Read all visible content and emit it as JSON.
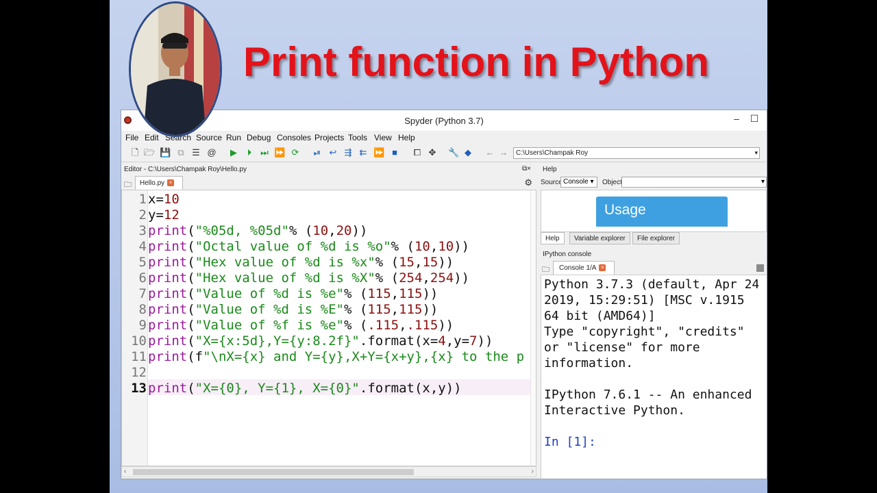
{
  "slide": {
    "headline": "Print function in Python"
  },
  "window": {
    "title": "Spyder (Python 3.7)",
    "minimize": "–",
    "maximize": "☐"
  },
  "menu": [
    "File",
    "Edit",
    "Search",
    "Source",
    "Run",
    "Debug",
    "Consoles",
    "Projects",
    "Tools",
    "View",
    "Help"
  ],
  "toolbar": {
    "path": "C:\\Users\\Champak Roy"
  },
  "editor": {
    "header": "Editor - C:\\Users\\Champak Roy\\Hello.py",
    "tab": "Hello.py",
    "lines": [
      {
        "n": "1",
        "parts": [
          [
            "plain",
            "x="
          ],
          [
            "num",
            "10"
          ]
        ]
      },
      {
        "n": "2",
        "parts": [
          [
            "plain",
            "y="
          ],
          [
            "num",
            "12"
          ]
        ]
      },
      {
        "n": "3",
        "parts": [
          [
            "kw",
            "print"
          ],
          [
            "plain",
            "("
          ],
          [
            "str",
            "\"%05d, %05d\""
          ],
          [
            "plain",
            "% ("
          ],
          [
            "num",
            "10"
          ],
          [
            "plain",
            ","
          ],
          [
            "num",
            "20"
          ],
          [
            "plain",
            "))"
          ]
        ]
      },
      {
        "n": "4",
        "parts": [
          [
            "kw",
            "print"
          ],
          [
            "plain",
            "("
          ],
          [
            "str",
            "\"Octal value of %d is %o\""
          ],
          [
            "plain",
            "% ("
          ],
          [
            "num",
            "10"
          ],
          [
            "plain",
            ","
          ],
          [
            "num",
            "10"
          ],
          [
            "plain",
            "))"
          ]
        ]
      },
      {
        "n": "5",
        "parts": [
          [
            "kw",
            "print"
          ],
          [
            "plain",
            "("
          ],
          [
            "str",
            "\"Hex value of %d is %x\""
          ],
          [
            "plain",
            "% ("
          ],
          [
            "num",
            "15"
          ],
          [
            "plain",
            ","
          ],
          [
            "num",
            "15"
          ],
          [
            "plain",
            "))"
          ]
        ]
      },
      {
        "n": "6",
        "parts": [
          [
            "kw",
            "print"
          ],
          [
            "plain",
            "("
          ],
          [
            "str",
            "\"Hex value of %d is %X\""
          ],
          [
            "plain",
            "% ("
          ],
          [
            "num",
            "254"
          ],
          [
            "plain",
            ","
          ],
          [
            "num",
            "254"
          ],
          [
            "plain",
            "))"
          ]
        ]
      },
      {
        "n": "7",
        "parts": [
          [
            "kw",
            "print"
          ],
          [
            "plain",
            "("
          ],
          [
            "str",
            "\"Value of %d is %e\""
          ],
          [
            "plain",
            "% ("
          ],
          [
            "num",
            "115"
          ],
          [
            "plain",
            ","
          ],
          [
            "num",
            "115"
          ],
          [
            "plain",
            "))"
          ]
        ]
      },
      {
        "n": "8",
        "parts": [
          [
            "kw",
            "print"
          ],
          [
            "plain",
            "("
          ],
          [
            "str",
            "\"Value of %d is %E\""
          ],
          [
            "plain",
            "% ("
          ],
          [
            "num",
            "115"
          ],
          [
            "plain",
            ","
          ],
          [
            "num",
            "115"
          ],
          [
            "plain",
            "))"
          ]
        ]
      },
      {
        "n": "9",
        "parts": [
          [
            "kw",
            "print"
          ],
          [
            "plain",
            "("
          ],
          [
            "str",
            "\"Value of %f is %e\""
          ],
          [
            "plain",
            "% ("
          ],
          [
            "num",
            ".115"
          ],
          [
            "plain",
            ","
          ],
          [
            "num",
            ".115"
          ],
          [
            "plain",
            "))"
          ]
        ]
      },
      {
        "n": "10",
        "parts": [
          [
            "kw",
            "print"
          ],
          [
            "plain",
            "("
          ],
          [
            "str",
            "\"X={x:5d},Y={y:8.2f}\""
          ],
          [
            "plain",
            ".format(x="
          ],
          [
            "num",
            "4"
          ],
          [
            "plain",
            ",y="
          ],
          [
            "num",
            "7"
          ],
          [
            "plain",
            "))"
          ]
        ]
      },
      {
        "n": "11",
        "parts": [
          [
            "kw",
            "print"
          ],
          [
            "plain",
            "(f"
          ],
          [
            "str",
            "\"\\nX={x} and Y={y},X+Y={x+y},{x} to the p"
          ]
        ]
      },
      {
        "n": "12",
        "parts": []
      },
      {
        "n": "13",
        "parts": [
          [
            "kw",
            "print"
          ],
          [
            "plain",
            "("
          ],
          [
            "str",
            "\"X={0}, Y={1}, X={0}\""
          ],
          [
            "plain",
            ".format(x,y))"
          ]
        ]
      }
    ]
  },
  "help": {
    "header": "Help",
    "source_label": "Source",
    "source_value": "Console",
    "object_label": "Object",
    "usage": "Usage",
    "tabs": [
      "Help",
      "Variable explorer",
      "File explorer"
    ]
  },
  "console": {
    "header": "IPython console",
    "tab": "Console 1/A",
    "lines": [
      "Python 3.7.3 (default, Apr 24",
      "2019, 15:29:51) [MSC v.1915",
      "64 bit (AMD64)]",
      "Type \"copyright\", \"credits\"",
      "or \"license\" for more",
      "information.",
      "",
      "IPython 7.6.1 -- An enhanced",
      "Interactive Python.",
      "",
      "In [1]:"
    ]
  },
  "colors": {
    "headline": "#e4131a",
    "keyword": "#9a1a9a",
    "string": "#1a8a1a",
    "number": "#8a1010"
  }
}
